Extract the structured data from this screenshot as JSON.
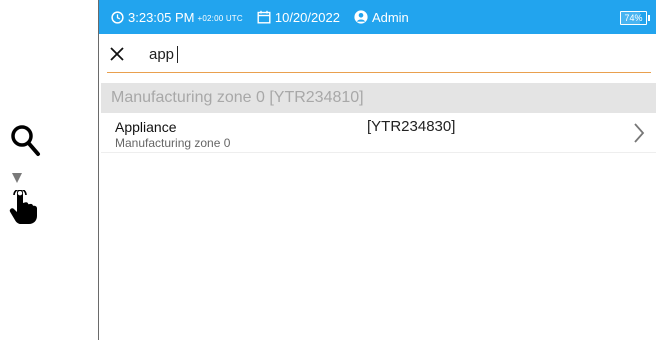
{
  "status_bar": {
    "time": "3:23:05 PM",
    "timezone": "+02:00 UTC",
    "date": "10/20/2022",
    "user": "Admin",
    "battery": "74%",
    "battery_level": 0.74,
    "background_color": "#22a4ee"
  },
  "search": {
    "value": "app",
    "underline_color": "#e9a04e"
  },
  "results": {
    "group_header": "Manufacturing zone 0 [YTR234810]",
    "items": [
      {
        "name": "Appliance",
        "subtitle": "Manufacturing zone 0",
        "code": "[YTR234830]"
      }
    ]
  },
  "icons": {
    "hint": [
      "search-icon",
      "arrow-down-icon",
      "tap-hand-icon"
    ],
    "status": [
      "clock-icon",
      "calendar-icon",
      "user-icon",
      "battery-icon"
    ],
    "actions": [
      "close-icon",
      "chevron-right-icon"
    ]
  }
}
